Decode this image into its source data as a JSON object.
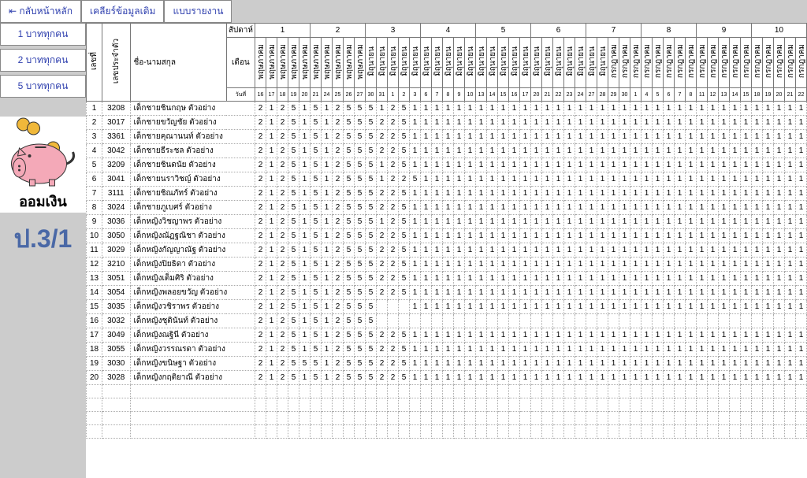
{
  "header": {
    "back": "⇤ กลับหน้าหลัก",
    "clear": "เคลียร์ข้อมูลเดิม",
    "report": "แบบรายงาน"
  },
  "sidebar": {
    "b1": "1 บาททุกคน",
    "b2": "2 บาททุกคน",
    "b5": "5 บาททุกคน",
    "piggy_caption": "ออมเงิน",
    "class": "ป.3/1"
  },
  "thead": {
    "idx": "เลขที่",
    "sid": "เลขประจำตัว",
    "name": "ชื่อ-นามสกุล",
    "week": "สัปดาห์",
    "month": "เดือน",
    "day": "วันที่",
    "weeks": [
      "1",
      "2",
      "3",
      "4",
      "5",
      "6",
      "7",
      "8",
      "9",
      "10"
    ],
    "months": [
      "พฤษภาคม",
      "พฤษภาคม",
      "พฤษภาคม",
      "พฤษภาคม",
      "พฤษภาคม",
      "พฤษภาคม",
      "พฤษภาคม",
      "พฤษภาคม",
      "พฤษภาคม",
      "พฤษภาคม",
      "มิถุนายน",
      "มิถุนายน",
      "มิถุนายน",
      "มิถุนายน",
      "มิถุนายน",
      "มิถุนายน",
      "มิถุนายน",
      "มิถุนายน",
      "มิถุนายน",
      "มิถุนายน",
      "มิถุนายน",
      "มิถุนายน",
      "มิถุนายน",
      "มิถุนายน",
      "มิถุนายน",
      "มิถุนายน",
      "มิถุนายน",
      "มิถุนายน",
      "มิถุนายน",
      "มิถุนายน",
      "มิถุนายน",
      "มิถุนายน",
      "กรกฎาคม",
      "กรกฎาคม",
      "กรกฎาคม",
      "กรกฎาคม",
      "กรกฎาคม",
      "กรกฎาคม",
      "กรกฎาคม",
      "กรกฎาคม",
      "กรกฎาคม",
      "กรกฎาคม",
      "กรกฎาคม",
      "กรกฎาคม",
      "กรกฎาคม",
      "กรกฎาคม",
      "กรกฎาคม",
      "กรกฎาคม",
      "กรกฎาคม",
      "กรกฎาคม"
    ],
    "days": [
      "16",
      "17",
      "18",
      "19",
      "20",
      "21",
      "24",
      "25",
      "26",
      "27",
      "30",
      "31",
      "1",
      "2",
      "3",
      "6",
      "7",
      "8",
      "9",
      "10",
      "13",
      "14",
      "15",
      "16",
      "17",
      "20",
      "21",
      "22",
      "23",
      "24",
      "27",
      "28",
      "29",
      "30",
      "1",
      "4",
      "5",
      "6",
      "7",
      "8",
      "11",
      "12",
      "13",
      "14",
      "15",
      "18",
      "19",
      "20",
      "21",
      "22"
    ]
  },
  "grid_cols": 50,
  "students": [
    {
      "sid": "3208",
      "name": "เด็กชายชินกฤษ  ตัวอย่าง",
      "vals": [
        2,
        1,
        2,
        5,
        1,
        5,
        1,
        2,
        5,
        5,
        5,
        1,
        2,
        5,
        1,
        1,
        1,
        1,
        1,
        1,
        1,
        1,
        1,
        1,
        1,
        1,
        1,
        1,
        1,
        1,
        1,
        1,
        1,
        1,
        1,
        1,
        1,
        1,
        1,
        1,
        1,
        1,
        1,
        1,
        1,
        1,
        1,
        1,
        1,
        1
      ]
    },
    {
      "sid": "3017",
      "name": "เด็กชายขวัญชัย  ตัวอย่าง",
      "vals": [
        2,
        1,
        2,
        5,
        1,
        5,
        1,
        2,
        5,
        5,
        5,
        2,
        2,
        5,
        1,
        1,
        1,
        1,
        1,
        1,
        1,
        1,
        1,
        1,
        1,
        1,
        1,
        1,
        1,
        1,
        1,
        1,
        1,
        1,
        1,
        1,
        1,
        1,
        1,
        1,
        1,
        1,
        1,
        1,
        1,
        1,
        1,
        1,
        1,
        1
      ]
    },
    {
      "sid": "3361",
      "name": "เด็กชายคุณานนท์  ตัวอย่าง",
      "vals": [
        2,
        1,
        2,
        5,
        1,
        5,
        1,
        2,
        5,
        5,
        5,
        2,
        2,
        5,
        1,
        1,
        1,
        1,
        1,
        1,
        1,
        1,
        1,
        1,
        1,
        1,
        1,
        1,
        1,
        1,
        1,
        1,
        1,
        1,
        1,
        1,
        1,
        1,
        1,
        1,
        1,
        1,
        1,
        1,
        1,
        1,
        1,
        1,
        1,
        1
      ]
    },
    {
      "sid": "3042",
      "name": "เด็กชายธีระชล  ตัวอย่าง",
      "vals": [
        2,
        1,
        2,
        5,
        1,
        5,
        1,
        2,
        5,
        5,
        5,
        2,
        2,
        5,
        1,
        1,
        1,
        1,
        1,
        1,
        1,
        1,
        1,
        1,
        1,
        1,
        1,
        1,
        1,
        1,
        1,
        1,
        1,
        1,
        1,
        1,
        1,
        1,
        1,
        1,
        1,
        1,
        1,
        1,
        1,
        1,
        1,
        1,
        1,
        1
      ]
    },
    {
      "sid": "3209",
      "name": "เด็กชายชินดนัย  ตัวอย่าง",
      "vals": [
        2,
        1,
        2,
        5,
        1,
        5,
        1,
        2,
        5,
        5,
        5,
        1,
        2,
        5,
        1,
        1,
        1,
        1,
        1,
        1,
        1,
        1,
        1,
        1,
        1,
        1,
        1,
        1,
        1,
        1,
        1,
        1,
        1,
        1,
        1,
        1,
        1,
        1,
        1,
        1,
        1,
        1,
        1,
        1,
        1,
        1,
        1,
        1,
        1,
        1
      ]
    },
    {
      "sid": "3041",
      "name": "เด็กชายนราวิชญ์  ตัวอย่าง",
      "vals": [
        2,
        1,
        2,
        5,
        1,
        5,
        1,
        2,
        5,
        5,
        5,
        1,
        2,
        2,
        5,
        1,
        1,
        1,
        1,
        1,
        1,
        1,
        1,
        1,
        1,
        1,
        1,
        1,
        1,
        1,
        1,
        1,
        1,
        1,
        1,
        1,
        1,
        1,
        1,
        1,
        1,
        1,
        1,
        1,
        1,
        1,
        1,
        1,
        1,
        1
      ]
    },
    {
      "sid": "3111",
      "name": "เด็กชายชิณภัทร์  ตัวอย่าง",
      "vals": [
        2,
        1,
        2,
        5,
        1,
        5,
        1,
        2,
        5,
        5,
        5,
        2,
        2,
        5,
        1,
        1,
        1,
        1,
        1,
        1,
        1,
        1,
        1,
        1,
        1,
        1,
        1,
        1,
        1,
        1,
        1,
        1,
        1,
        1,
        1,
        1,
        1,
        1,
        1,
        1,
        1,
        1,
        1,
        1,
        1,
        1,
        1,
        1,
        1,
        1
      ]
    },
    {
      "sid": "3024",
      "name": "เด็กชายภูเบศร์  ตัวอย่าง",
      "vals": [
        2,
        1,
        2,
        5,
        1,
        5,
        1,
        2,
        5,
        5,
        5,
        2,
        2,
        5,
        1,
        1,
        1,
        1,
        1,
        1,
        1,
        1,
        1,
        1,
        1,
        1,
        1,
        1,
        1,
        1,
        1,
        1,
        1,
        1,
        1,
        1,
        1,
        1,
        1,
        1,
        1,
        1,
        1,
        1,
        1,
        1,
        1,
        1,
        1,
        1
      ]
    },
    {
      "sid": "3036",
      "name": "เด็กหญิงวิชญาพร  ตัวอย่าง",
      "vals": [
        2,
        1,
        2,
        5,
        1,
        5,
        1,
        2,
        5,
        5,
        5,
        1,
        2,
        5,
        1,
        1,
        1,
        1,
        1,
        1,
        1,
        1,
        1,
        1,
        1,
        1,
        1,
        1,
        1,
        1,
        1,
        1,
        1,
        1,
        1,
        1,
        1,
        1,
        1,
        1,
        1,
        1,
        1,
        1,
        1,
        1,
        1,
        1,
        1,
        1
      ]
    },
    {
      "sid": "3050",
      "name": "เด็กหญิงณัฏฐณิชา  ตัวอย่าง",
      "vals": [
        2,
        1,
        2,
        5,
        1,
        5,
        1,
        2,
        5,
        5,
        5,
        2,
        2,
        5,
        1,
        1,
        1,
        1,
        1,
        1,
        1,
        1,
        1,
        1,
        1,
        1,
        1,
        1,
        1,
        1,
        1,
        1,
        1,
        1,
        1,
        1,
        1,
        1,
        1,
        1,
        1,
        1,
        1,
        1,
        1,
        1,
        1,
        1,
        1,
        1
      ]
    },
    {
      "sid": "3029",
      "name": "เด็กหญิงกัญญาณัฐ  ตัวอย่าง",
      "vals": [
        2,
        1,
        2,
        5,
        1,
        5,
        1,
        2,
        5,
        5,
        5,
        2,
        2,
        5,
        1,
        1,
        1,
        1,
        1,
        1,
        1,
        1,
        1,
        1,
        1,
        1,
        1,
        1,
        1,
        1,
        1,
        1,
        1,
        1,
        1,
        1,
        1,
        1,
        1,
        1,
        1,
        1,
        1,
        1,
        1,
        1,
        1,
        1,
        1,
        1
      ]
    },
    {
      "sid": "3210",
      "name": "เด็กหญิงปิยธิดา  ตัวอย่าง",
      "vals": [
        2,
        1,
        2,
        5,
        1,
        5,
        1,
        2,
        5,
        5,
        5,
        2,
        2,
        5,
        1,
        1,
        1,
        1,
        1,
        1,
        1,
        1,
        1,
        1,
        1,
        1,
        1,
        1,
        1,
        1,
        1,
        1,
        1,
        1,
        1,
        1,
        1,
        1,
        1,
        1,
        1,
        1,
        1,
        1,
        1,
        1,
        1,
        1,
        1,
        1
      ]
    },
    {
      "sid": "3051",
      "name": "เด็กหญิงเต็มศิริ  ตัวอย่าง",
      "vals": [
        2,
        1,
        2,
        5,
        1,
        5,
        1,
        2,
        5,
        5,
        5,
        2,
        2,
        5,
        1,
        1,
        1,
        1,
        1,
        1,
        1,
        1,
        1,
        1,
        1,
        1,
        1,
        1,
        1,
        1,
        1,
        1,
        1,
        1,
        1,
        1,
        1,
        1,
        1,
        1,
        1,
        1,
        1,
        1,
        1,
        1,
        1,
        1,
        1,
        1
      ]
    },
    {
      "sid": "3054",
      "name": "เด็กหญิงพลอยขวัญ  ตัวอย่าง",
      "vals": [
        2,
        1,
        2,
        5,
        1,
        5,
        1,
        2,
        5,
        5,
        5,
        2,
        2,
        5,
        1,
        1,
        1,
        1,
        1,
        1,
        1,
        1,
        1,
        1,
        1,
        1,
        1,
        1,
        1,
        1,
        1,
        1,
        1,
        1,
        1,
        1,
        1,
        1,
        1,
        1,
        1,
        1,
        1,
        1,
        1,
        1,
        1,
        1,
        1,
        1
      ]
    },
    {
      "sid": "3035",
      "name": "เด็กหญิงวชิราพร  ตัวอย่าง",
      "vals": [
        2,
        1,
        2,
        5,
        1,
        5,
        1,
        2,
        5,
        5,
        5,
        "",
        "",
        "",
        1,
        1,
        1,
        1,
        1,
        1,
        1,
        1,
        1,
        1,
        1,
        1,
        1,
        1,
        1,
        1,
        1,
        1,
        1,
        1,
        1,
        1,
        1,
        1,
        1,
        1,
        1,
        1,
        1,
        1,
        1,
        1,
        1,
        1,
        1,
        1
      ]
    },
    {
      "sid": "3032",
      "name": "เด็กหญิงชุตินันท์  ตัวอย่าง",
      "vals": [
        2,
        1,
        2,
        5,
        1,
        5,
        1,
        2,
        5,
        5,
        5,
        "",
        "",
        "",
        "",
        "",
        "",
        "",
        "",
        "",
        "",
        "",
        "",
        "",
        "",
        "",
        "",
        "",
        "",
        "",
        "",
        "",
        "",
        "",
        "",
        "",
        "",
        "",
        "",
        "",
        "",
        "",
        "",
        "",
        "",
        "",
        "",
        "",
        "",
        ""
      ]
    },
    {
      "sid": "3049",
      "name": "เด็กหญิงณฐินี  ตัวอย่าง",
      "vals": [
        2,
        1,
        2,
        5,
        1,
        5,
        1,
        2,
        5,
        5,
        5,
        2,
        2,
        5,
        1,
        1,
        1,
        1,
        1,
        1,
        1,
        1,
        1,
        1,
        1,
        1,
        1,
        1,
        1,
        1,
        1,
        1,
        1,
        1,
        1,
        1,
        1,
        1,
        1,
        1,
        1,
        1,
        1,
        1,
        1,
        1,
        1,
        1,
        1,
        1
      ]
    },
    {
      "sid": "3055",
      "name": "เด็กหญิงวรรณรดา  ตัวอย่าง",
      "vals": [
        2,
        1,
        2,
        5,
        1,
        5,
        1,
        2,
        5,
        5,
        5,
        2,
        2,
        5,
        1,
        1,
        1,
        1,
        1,
        1,
        1,
        1,
        1,
        1,
        1,
        1,
        1,
        1,
        1,
        1,
        1,
        1,
        1,
        1,
        1,
        1,
        1,
        1,
        1,
        1,
        1,
        1,
        1,
        1,
        1,
        1,
        1,
        1,
        1,
        1
      ]
    },
    {
      "sid": "3030",
      "name": "เด็กหญิงขนิษฐา  ตัวอย่าง",
      "vals": [
        2,
        1,
        2,
        5,
        5,
        5,
        1,
        2,
        5,
        5,
        5,
        2,
        2,
        5,
        1,
        1,
        1,
        1,
        1,
        1,
        1,
        1,
        1,
        1,
        1,
        1,
        1,
        1,
        1,
        1,
        1,
        1,
        1,
        1,
        1,
        1,
        1,
        1,
        1,
        1,
        1,
        1,
        1,
        1,
        1,
        1,
        1,
        1,
        1,
        1
      ]
    },
    {
      "sid": "3028",
      "name": "เด็กหญิงกฤติยาณี  ตัวอย่าง",
      "vals": [
        2,
        1,
        2,
        5,
        1,
        5,
        1,
        2,
        5,
        5,
        5,
        2,
        2,
        5,
        1,
        1,
        1,
        1,
        1,
        1,
        1,
        1,
        1,
        1,
        1,
        1,
        1,
        1,
        1,
        1,
        1,
        1,
        1,
        1,
        1,
        1,
        1,
        1,
        1,
        1,
        1,
        1,
        1,
        1,
        1,
        1,
        1,
        1,
        1,
        1
      ]
    }
  ],
  "empty_rows": 4
}
